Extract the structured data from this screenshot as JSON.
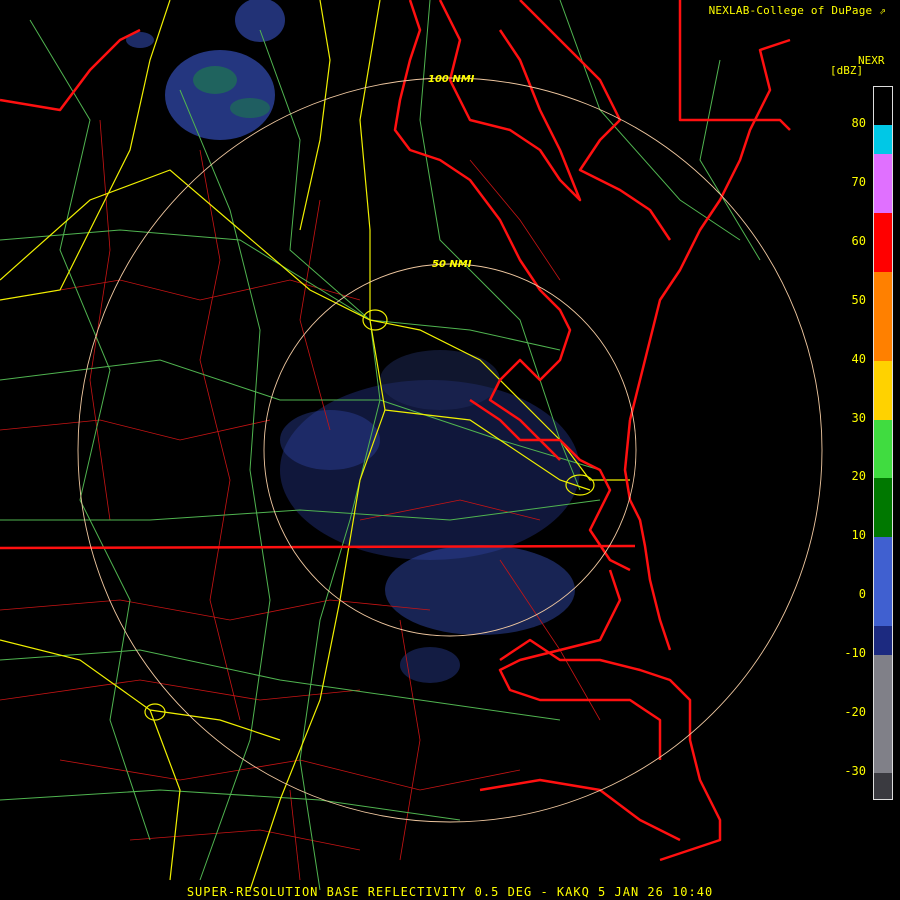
{
  "credit": "NEXLAB-College of DuPage",
  "product": "NEXR",
  "unit": "[dBZ]",
  "range_rings": [
    "100 NMI",
    "50 NMI"
  ],
  "footer": "SUPER-RESOLUTION BASE REFLECTIVITY 0.5 DEG - KAKQ 5 JAN 26 10:40",
  "colorbar": {
    "ticks": [
      "80",
      "70",
      "60",
      "50",
      "40",
      "30",
      "20",
      "10",
      "0",
      "-10",
      "-20",
      "-30"
    ],
    "segments": [
      {
        "from": 80,
        "to": 75,
        "color": "#00c8e6"
      },
      {
        "from": 75,
        "to": 65,
        "color": "#e070ff"
      },
      {
        "from": 65,
        "to": 55,
        "color": "#ff0000"
      },
      {
        "from": 55,
        "to": 40,
        "color": "#ff8000"
      },
      {
        "from": 40,
        "to": 30,
        "color": "#ffd200"
      },
      {
        "from": 30,
        "to": 20,
        "color": "#40dc40"
      },
      {
        "from": 20,
        "to": 10,
        "color": "#007800"
      },
      {
        "from": 10,
        "to": -5,
        "color": "#4060d0"
      },
      {
        "from": -5,
        "to": -10,
        "color": "#1c2a80"
      },
      {
        "from": -10,
        "to": -30,
        "color": "#808088"
      },
      {
        "from": -30,
        "to": -35,
        "color": "#3a3a40"
      }
    ]
  }
}
